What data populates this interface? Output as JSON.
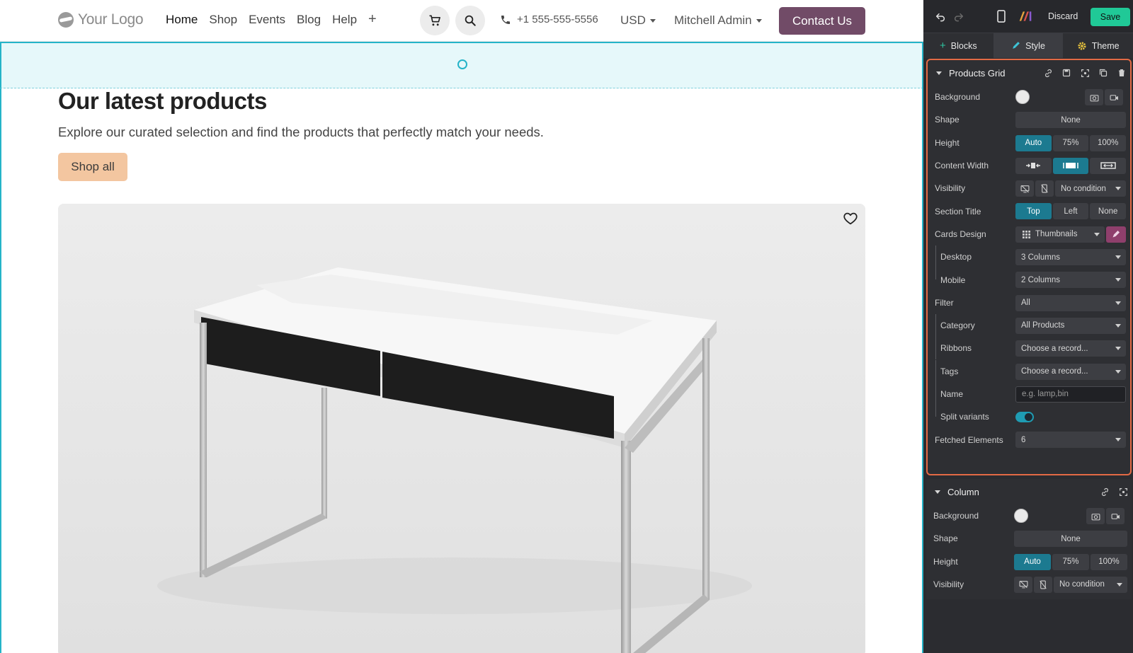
{
  "header": {
    "logo_text": "Your Logo",
    "nav": [
      "Home",
      "Shop",
      "Events",
      "Blog",
      "Help"
    ],
    "nav_add": "+",
    "phone": "+1 555-555-5556",
    "currency": "USD",
    "user": "Mitchell Admin",
    "contact_label": "Contact Us"
  },
  "section": {
    "title": "Our latest products",
    "subtitle": "Explore our curated selection and find the products that perfectly match your needs.",
    "shop_all": "Shop all"
  },
  "editor": {
    "discard": "Discard",
    "save": "Save",
    "tabs": [
      "Blocks",
      "Style",
      "Theme"
    ],
    "products_grid": {
      "title": "Products Grid",
      "background_label": "Background",
      "shape_label": "Shape",
      "shape_value": "None",
      "height_label": "Height",
      "height_options": [
        "Auto",
        "75%",
        "100%"
      ],
      "content_width_label": "Content Width",
      "visibility_label": "Visibility",
      "visibility_value": "No condition",
      "section_title_label": "Section Title",
      "section_title_options": [
        "Top",
        "Left",
        "None"
      ],
      "cards_design_label": "Cards Design",
      "cards_design_value": "Thumbnails",
      "desktop_label": "Desktop",
      "desktop_value": "3 Columns",
      "mobile_label": "Mobile",
      "mobile_value": "2 Columns",
      "filter_label": "Filter",
      "filter_value": "All",
      "category_label": "Category",
      "category_value": "All Products",
      "ribbons_label": "Ribbons",
      "ribbons_value": "Choose a record...",
      "tags_label": "Tags",
      "tags_value": "Choose a record...",
      "name_label": "Name",
      "name_placeholder": "e.g. lamp,bin",
      "split_label": "Split variants",
      "fetched_label": "Fetched Elements",
      "fetched_value": "6"
    },
    "column": {
      "title": "Column",
      "background_label": "Background",
      "shape_label": "Shape",
      "shape_value": "None",
      "height_label": "Height",
      "height_options": [
        "Auto",
        "75%",
        "100%"
      ],
      "visibility_label": "Visibility",
      "visibility_value": "No condition"
    }
  }
}
